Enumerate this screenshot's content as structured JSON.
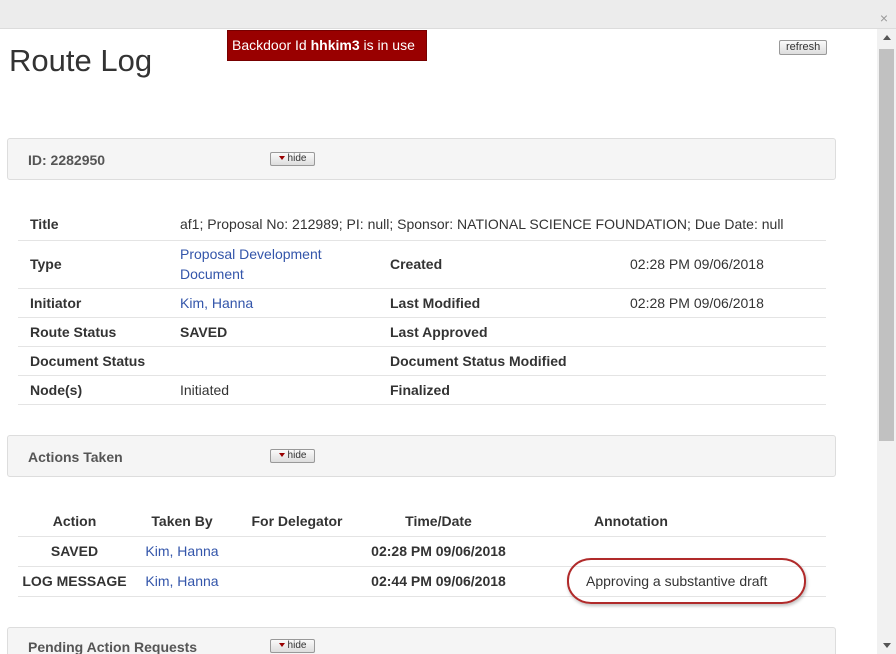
{
  "window": {
    "close_glyph": "×"
  },
  "page": {
    "title": "Route Log"
  },
  "backdoor": {
    "prefix": "Backdoor Id ",
    "user": "hhkim3",
    "suffix": " is in use",
    "color": "#990000"
  },
  "toolbar": {
    "refresh_label": "refresh"
  },
  "id_section": {
    "title": "ID: 2282950",
    "hide_label": "hide"
  },
  "document": {
    "title_label": "Title",
    "title_value": "af1; Proposal No: 212989; PI: null; Sponsor: NATIONAL SCIENCE FOUNDATION; Due Date: null",
    "type_label": "Type",
    "type_value": "Proposal Development Document",
    "created_label": "Created",
    "created_value": "02:28 PM 09/06/2018",
    "initiator_label": "Initiator",
    "initiator_value": "Kim, Hanna",
    "last_modified_label": "Last Modified",
    "last_modified_value": "02:28 PM 09/06/2018",
    "route_status_label": "Route Status",
    "route_status_value": "SAVED",
    "last_approved_label": "Last Approved",
    "last_approved_value": "",
    "doc_status_label": "Document Status",
    "doc_status_value": "",
    "doc_status_modified_label": "Document Status Modified",
    "doc_status_modified_value": "",
    "nodes_label": "Node(s)",
    "nodes_value": "Initiated",
    "finalized_label": "Finalized",
    "finalized_value": ""
  },
  "actions_section": {
    "title": "Actions Taken",
    "hide_label": "hide",
    "columns": [
      "Action",
      "Taken By",
      "For Delegator",
      "Time/Date",
      "Annotation"
    ],
    "rows": [
      {
        "action": "SAVED",
        "taken_by": "Kim, Hanna",
        "for_delegator": "",
        "time_date": "02:28 PM 09/06/2018",
        "annotation": ""
      },
      {
        "action": "LOG MESSAGE",
        "taken_by": "Kim, Hanna",
        "for_delegator": "",
        "time_date": "02:44 PM 09/06/2018",
        "annotation": "Approving a substantive draft"
      }
    ]
  },
  "pending_section": {
    "title": "Pending Action Requests",
    "hide_label": "hide"
  }
}
